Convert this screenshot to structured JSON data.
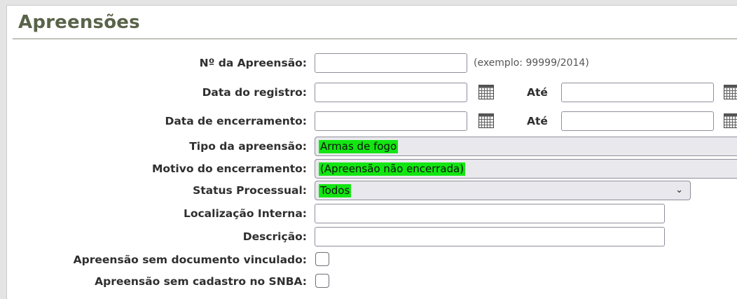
{
  "page": {
    "title": "Apreensões"
  },
  "form": {
    "numero": {
      "label": "Nº da Apreensão:",
      "value": "",
      "hint": "(exemplo: 99999/2014)"
    },
    "data_registro": {
      "label": "Data do registro:",
      "value_from": "",
      "ate_label": "Até",
      "value_to": ""
    },
    "data_encerramento": {
      "label": "Data de encerramento:",
      "value_from": "",
      "ate_label": "Até",
      "value_to": ""
    },
    "tipo": {
      "label": "Tipo da apreensão:",
      "selected": "Armas de fogo"
    },
    "motivo": {
      "label": "Motivo do encerramento:",
      "selected": "(Apreensão não encerrada)"
    },
    "status": {
      "label": "Status Processual:",
      "selected": "Todos"
    },
    "localizacao": {
      "label": "Localização Interna:",
      "value": ""
    },
    "descricao": {
      "label": "Descrição:",
      "value": ""
    },
    "sem_documento": {
      "label": "Apreensão sem documento vinculado:",
      "checked": false
    },
    "sem_snba": {
      "label": "Apreensão sem cadastro no SNBA:",
      "checked": false
    }
  },
  "icons": {
    "calendar": "calendar-icon",
    "chevron": "chevron-down-icon"
  },
  "colors": {
    "title": "#59634a",
    "selected_highlight": "#12e612",
    "select_bg": "#e9e9ed"
  }
}
